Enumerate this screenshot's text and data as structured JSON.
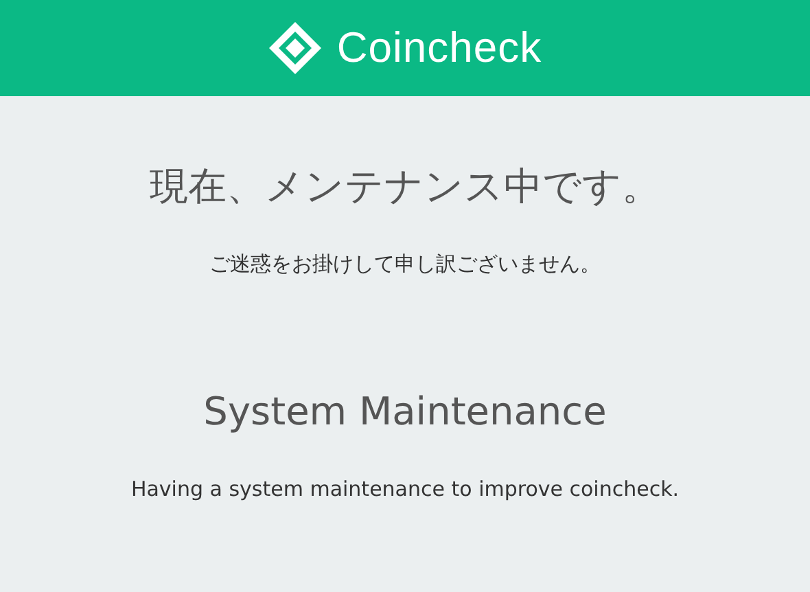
{
  "header": {
    "brand": "Coincheck"
  },
  "sections": [
    {
      "title": "現在、メンテナンス中です。",
      "message": "ご迷惑をお掛けして申し訳ございません。"
    },
    {
      "title": "System Maintenance",
      "message": "Having a system maintenance to improve coincheck."
    }
  ]
}
